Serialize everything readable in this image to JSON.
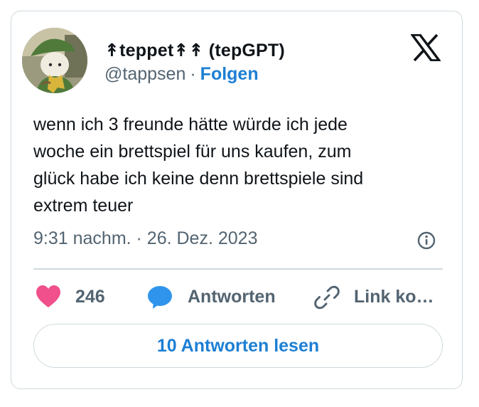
{
  "tweet": {
    "author": {
      "display_name": "↟teppet↟↟ (tepGPT)",
      "handle": "@tappsen",
      "separator": "·",
      "follow_label": "Folgen"
    },
    "text": "wenn ich 3 freunde hätte würde ich jede\nwoche ein brettspiel für uns kaufen, zum\nglück habe ich keine denn brettspiele sind\nextrem teuer",
    "timestamp": "9:31 nachm. · 26. Dez. 2023",
    "actions": {
      "like_count": "246",
      "reply_label": "Antworten",
      "link_label": "Link ko…"
    },
    "read_replies_label": "10 Antworten lesen"
  },
  "icons": {
    "logo": "x-logo-icon",
    "info": "info-icon",
    "like": "heart-icon",
    "reply": "speech-bubble-icon",
    "link": "link-icon"
  },
  "colors": {
    "text": "#0f1419",
    "secondary_text": "#536471",
    "accent_blue": "#1d7fd4",
    "heart": "#f0508c",
    "reply_bubble": "#2f95ec",
    "border": "#cfd9de"
  }
}
